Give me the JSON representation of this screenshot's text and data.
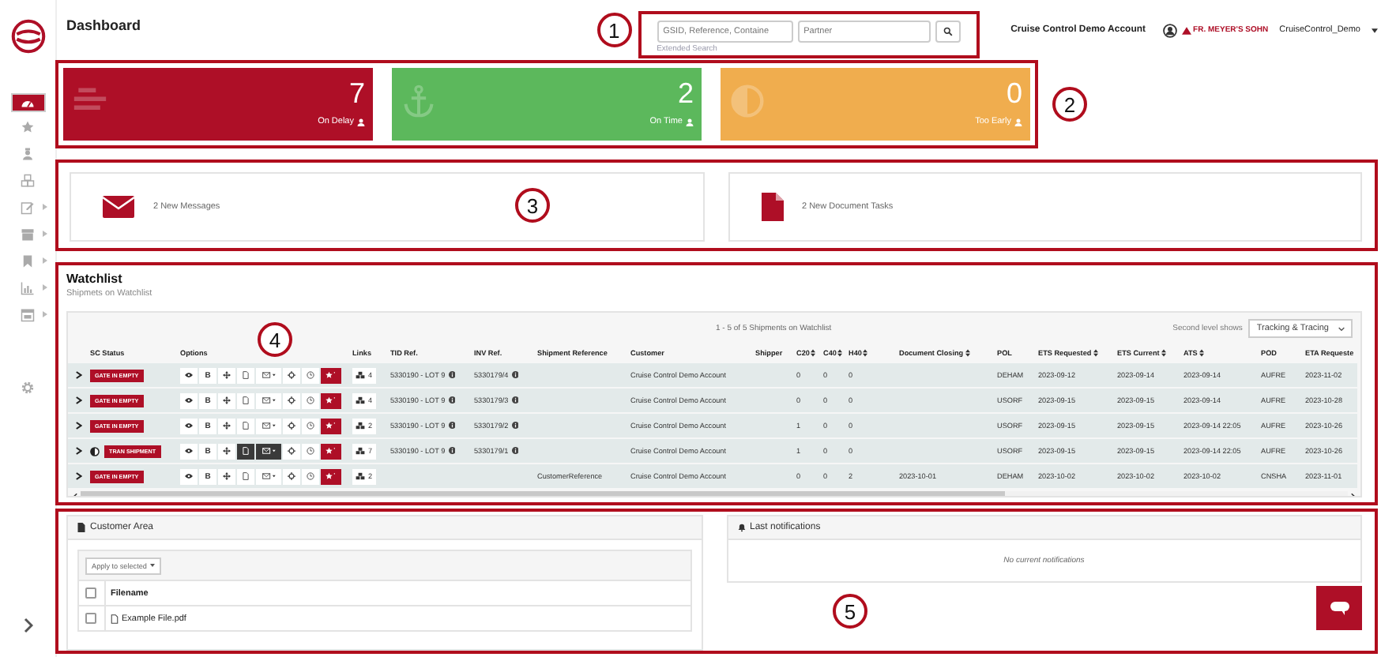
{
  "sidebar": {
    "items": [
      {
        "kind": "dashboard",
        "selected": true,
        "submenu": false
      },
      {
        "kind": "star",
        "selected": false,
        "submenu": false
      },
      {
        "kind": "bust",
        "selected": false,
        "submenu": false
      },
      {
        "kind": "cubes",
        "selected": false,
        "submenu": false
      },
      {
        "kind": "edit",
        "selected": false,
        "submenu": true
      },
      {
        "kind": "box",
        "selected": false,
        "submenu": true
      },
      {
        "kind": "bookmark",
        "selected": false,
        "submenu": true
      },
      {
        "kind": "chart",
        "selected": false,
        "submenu": true
      },
      {
        "kind": "calendar",
        "selected": false,
        "submenu": true
      }
    ]
  },
  "header": {
    "title": "Dashboard",
    "search": {
      "reference_placeholder": "GSID, Reference, Containe",
      "partner_placeholder": "Partner",
      "extended_search": "Extended Search"
    },
    "account": "Cruise Control Demo Account",
    "logo": "FR. MEYER'S SOHN",
    "user": "CruiseControl_Demo"
  },
  "callouts": [
    "1",
    "2",
    "3",
    "4",
    "5"
  ],
  "cards": [
    {
      "kind": "delay",
      "value": "7",
      "label": "On Delay",
      "color": "#ae0f27"
    },
    {
      "kind": "ontime",
      "value": "2",
      "label": "On Time",
      "color": "#5cb85c"
    },
    {
      "kind": "early",
      "value": "0",
      "label": "Too Early",
      "color": "#f0ad4e"
    }
  ],
  "messages": [
    {
      "kind": "messages",
      "text": "2 New Messages"
    },
    {
      "kind": "documents",
      "text": "2 New Document Tasks"
    }
  ],
  "watchlist": {
    "title": "Watchlist",
    "subtitle": "Shipmets on Watchlist",
    "summary": "1 - 5 of 5 Shipments on Watchlist",
    "level_label": "Second level shows",
    "level_value": "Tracking & Tracing",
    "columns": [
      {
        "label": "SC Status",
        "sortable": false
      },
      {
        "label": "Options",
        "sortable": false
      },
      {
        "label": "Links",
        "sortable": false
      },
      {
        "label": "TID Ref.",
        "sortable": false
      },
      {
        "label": "INV Ref.",
        "sortable": false
      },
      {
        "label": "Shipment Reference",
        "sortable": false
      },
      {
        "label": "Customer",
        "sortable": false
      },
      {
        "label": "Shipper",
        "sortable": false
      },
      {
        "label": "C20",
        "sortable": true
      },
      {
        "label": "C40",
        "sortable": true
      },
      {
        "label": "H40",
        "sortable": true
      },
      {
        "label": "Document Closing",
        "sortable": true
      },
      {
        "label": "POL",
        "sortable": false
      },
      {
        "label": "ETS Requested",
        "sortable": true
      },
      {
        "label": "ETS Current",
        "sortable": true
      },
      {
        "label": "ATS",
        "sortable": true
      },
      {
        "label": "POD",
        "sortable": false
      },
      {
        "label": "ETA Requeste",
        "sortable": false
      }
    ],
    "rows": [
      {
        "status": "GATE IN EMPTY",
        "status_icon": false,
        "documents_active": false,
        "bl_label": "B",
        "links": "4",
        "tid": "5330190 - LOT 9",
        "inv": "5330179/4",
        "customer": "Cruise Control Demo Account",
        "c20": "0",
        "c40": "0",
        "h40": "0",
        "pol": "DEHAM",
        "ets_requested": "2023-09-12",
        "ets_current": "2023-09-14",
        "ats": "2023-09-14",
        "pod": "AUFRE",
        "eta_requested": "2023-11-02"
      },
      {
        "status": "GATE IN EMPTY",
        "status_icon": false,
        "documents_active": false,
        "bl_label": "B",
        "links": "4",
        "tid": "5330190 - LOT 9",
        "inv": "5330179/3",
        "customer": "Cruise Control Demo Account",
        "c20": "0",
        "c40": "0",
        "h40": "0",
        "pol": "USORF",
        "ets_requested": "2023-09-15",
        "ets_current": "2023-09-15",
        "ats": "2023-09-14",
        "pod": "AUFRE",
        "eta_requested": "2023-10-28"
      },
      {
        "status": "GATE IN EMPTY",
        "status_icon": false,
        "documents_active": false,
        "bl_label": "B",
        "links": "2",
        "tid": "5330190 - LOT 9",
        "inv": "5330179/2",
        "customer": "Cruise Control Demo Account",
        "c20": "1",
        "c40": "0",
        "h40": "0",
        "pol": "USORF",
        "ets_requested": "2023-09-15",
        "ets_current": "2023-09-15",
        "ats": "2023-09-14 22:05",
        "pod": "AUFRE",
        "eta_requested": "2023-10-26"
      },
      {
        "status": "TRAN SHIPMENT",
        "status_icon": true,
        "documents_active": true,
        "bl_label": "B",
        "links": "7",
        "tid": "5330190 - LOT 9",
        "inv": "5330179/1",
        "customer": "Cruise Control Demo Account",
        "c20": "1",
        "c40": "0",
        "h40": "0",
        "pol": "USORF",
        "ets_requested": "2023-09-15",
        "ets_current": "2023-09-15",
        "ats": "2023-09-14 22:05",
        "pod": "AUFRE",
        "eta_requested": "2023-10-26"
      },
      {
        "status": "GATE IN EMPTY",
        "status_icon": false,
        "documents_active": false,
        "bl_label": "B",
        "links": "2",
        "shipment_reference": "CustomerReference",
        "customer": "Cruise Control Demo Account",
        "c20": "0",
        "c40": "0",
        "h40": "2",
        "document_closing": "2023-10-01",
        "pol": "DEHAM",
        "ets_requested": "2023-10-02",
        "ets_current": "2023-10-02",
        "ats": "2023-10-02",
        "pod": "CNSHA",
        "eta_requested": "2023-11-01"
      }
    ]
  },
  "customer_area": {
    "title": "Customer Area",
    "apply_button": "Apply to selected",
    "select_all_checked": false,
    "filename_header": "Filename",
    "files": [
      {
        "name": "Example File.pdf",
        "checked": false
      }
    ]
  },
  "notifications": {
    "title": "Last notifications",
    "empty_text": "No current notifications"
  }
}
